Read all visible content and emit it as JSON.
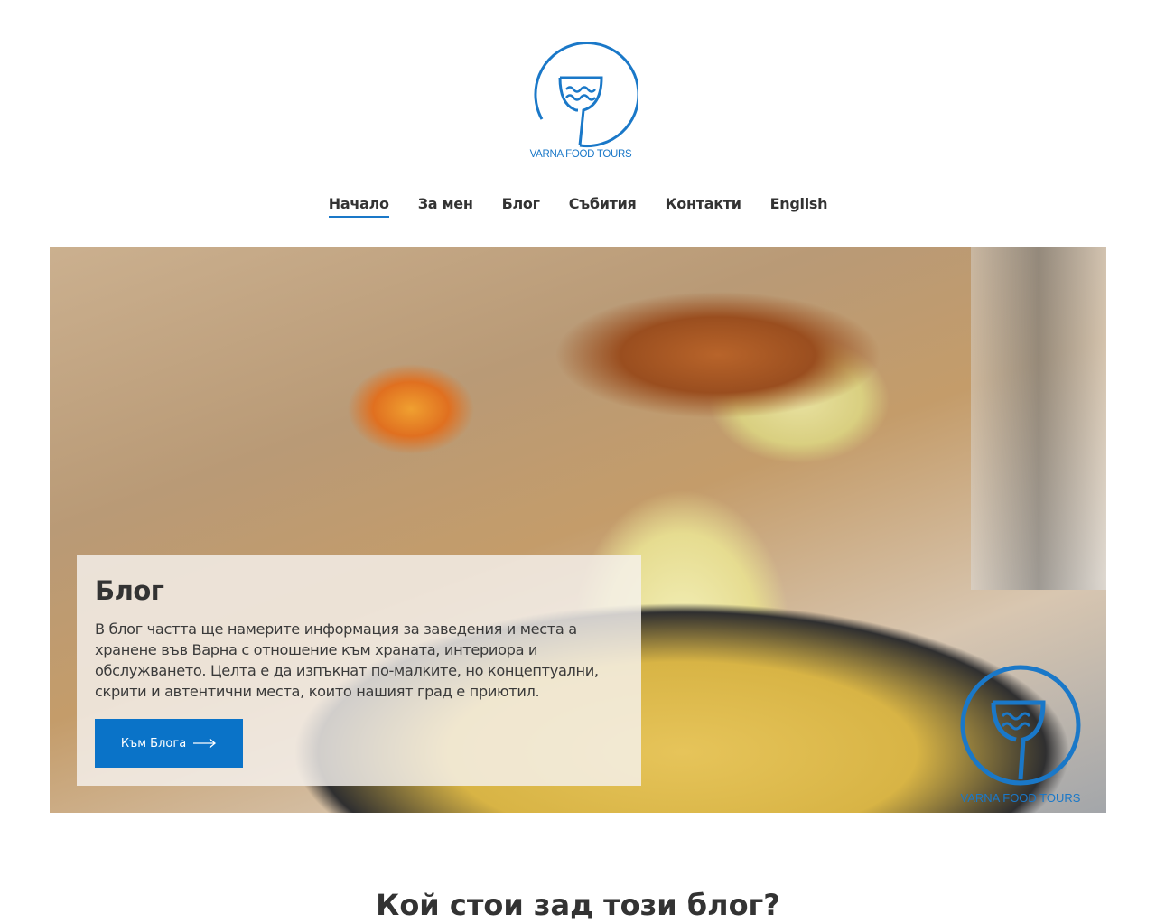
{
  "brand": {
    "logo_text": "VARNA FOOD TOURS",
    "accent": "#1a78c8"
  },
  "nav": {
    "items": [
      {
        "label": "Начало",
        "active": true
      },
      {
        "label": "За мен"
      },
      {
        "label": "Блог"
      },
      {
        "label": "Събития"
      },
      {
        "label": "Контакти"
      },
      {
        "label": "English"
      }
    ]
  },
  "hero": {
    "title": "Блог",
    "text": "В блог частта ще намерите информация за заведения и места а хранене във Варна с отношение към храната, интериора и обслужването. Целта е да изпъкнат по-малките, но концептуални, скрити и автентични места, които нашият град е приютил.",
    "button_label": "Към Блога",
    "button_color": "#0a73c8",
    "watermark_text": "VARNA FOOD TOURS"
  },
  "next_section": {
    "title": "Кой стои зад този блог?"
  }
}
